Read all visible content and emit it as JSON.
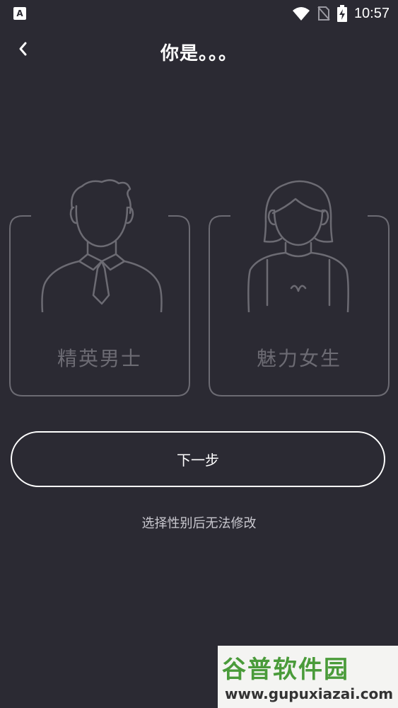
{
  "status_bar": {
    "app_icon_letter": "A",
    "time": "10:57",
    "icons": [
      "wifi-icon",
      "no-sim-icon",
      "battery-charging-icon"
    ]
  },
  "header": {
    "back_icon": "chevron-left-icon",
    "title": "你是。。。"
  },
  "options": {
    "male": {
      "label": "精英男士",
      "icon": "male-avatar-icon"
    },
    "female": {
      "label": "魅力女生",
      "icon": "female-avatar-icon"
    }
  },
  "actions": {
    "next_label": "下一步"
  },
  "hint": "选择性别后无法修改",
  "watermark": {
    "title": "谷普软件园",
    "url": "www.gupuxiazai.com"
  },
  "colors": {
    "background": "#2b2a33",
    "outline": "#6c6b73",
    "text": "#ffffff",
    "watermark_green": "#4a9b3a"
  }
}
